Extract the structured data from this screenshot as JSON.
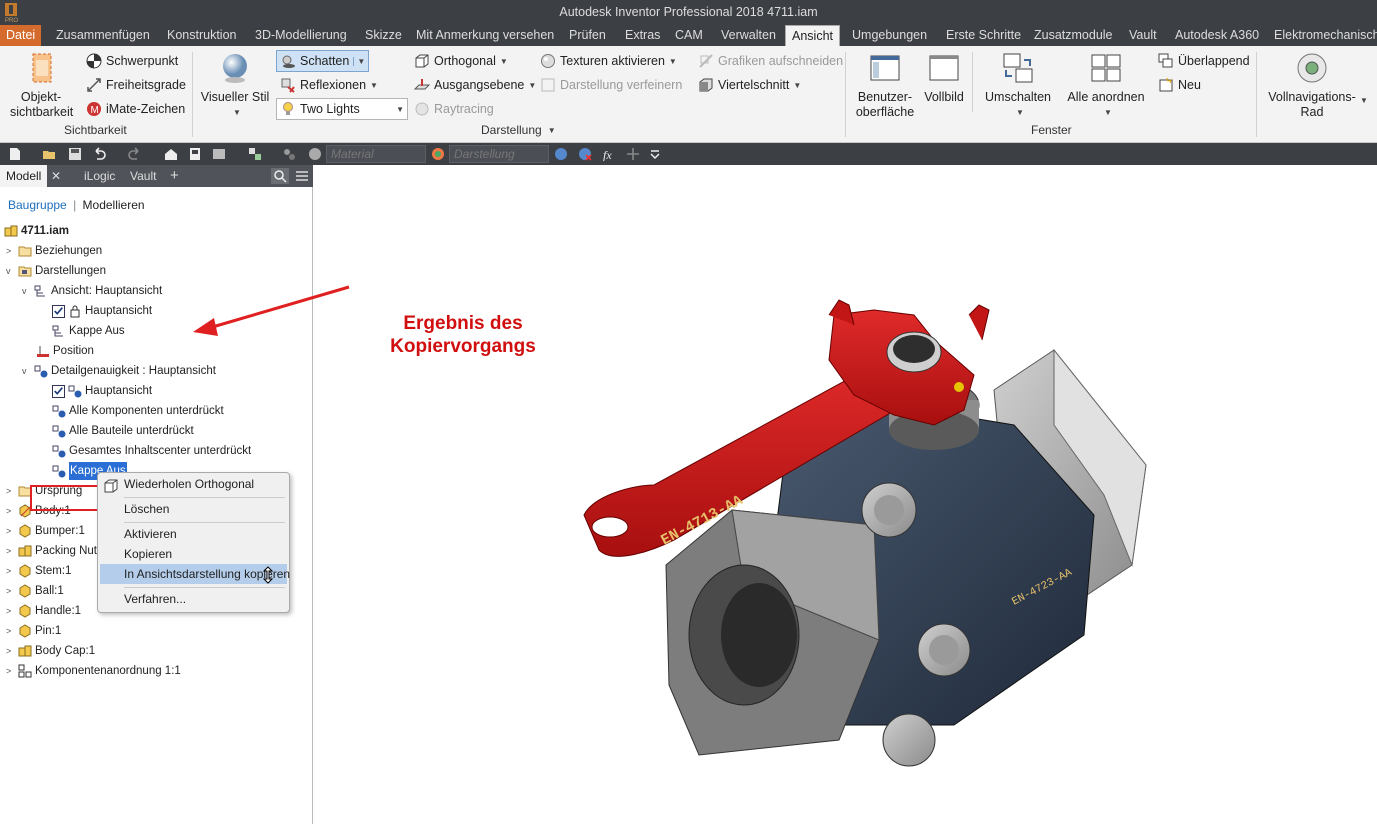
{
  "window": {
    "title": "Autodesk Inventor Professional 2018    4711.iam"
  },
  "tabs": [
    "Datei",
    "Zusammenfügen",
    "Konstruktion",
    "3D-Modellierung",
    "Skizze",
    "Mit Anmerkung versehen",
    "Prüfen",
    "Extras",
    "CAM",
    "Verwalten",
    "Ansicht",
    "Umgebungen",
    "Erste Schritte",
    "Zusatzmodule",
    "Vault",
    "Autodesk A360",
    "Elektromechanisch"
  ],
  "active_tab": "Ansicht",
  "ribbon": {
    "sichtbarkeit": {
      "objekt": "Objekt-",
      "objekt2": "sichtbarkeit",
      "schwerpunkt": "Schwerpunkt",
      "freiheitsgrade": "Freiheitsgrade",
      "imate": "iMate-Zeichen",
      "label": "Sichtbarkeit"
    },
    "darstellung": {
      "visueller_stil": "Visueller Stil",
      "schatten": "Schatten",
      "reflexionen": "Reflexionen",
      "two_lights": "Two Lights",
      "orthogonal": "Orthogonal",
      "ausgangsebene": "Ausgangsebene",
      "raytracing": "Raytracing",
      "texturen": "Texturen aktivieren",
      "darstellung_verfeinern": "Darstellung verfeinern",
      "grafiken": "Grafiken aufschneiden",
      "viertelschnitt": "Viertelschnitt",
      "label": "Darstellung"
    },
    "fenster": {
      "benutzer": "Benutzer-",
      "benutzer2": "oberfläche",
      "vollbild": "Vollbild",
      "umschalten": "Umschalten",
      "alle_anordnen": "Alle anordnen",
      "ueberlappend": "Überlappend",
      "neu": "Neu",
      "label": "Fenster"
    },
    "navigation": {
      "voll": "Vollnavigations-",
      "rad": "Rad"
    }
  },
  "qat": {
    "material_placeholder": "Material",
    "darstellung_placeholder": "Darstellung"
  },
  "browser": {
    "tabs": {
      "modell": "Modell",
      "ilogic": "iLogic",
      "vault": "Vault",
      "add": "+"
    },
    "subtabs": {
      "baugruppe": "Baugruppe",
      "sep": "|",
      "modellieren": "Modellieren"
    },
    "tree": [
      {
        "label": "4711.iam"
      },
      {
        "label": "Beziehungen"
      },
      {
        "label": "Darstellungen"
      },
      {
        "label": "Ansicht: Hauptansicht"
      },
      {
        "label": "Hauptansicht"
      },
      {
        "label": "Kappe Aus"
      },
      {
        "label": "Position"
      },
      {
        "label": "Detailgenauigkeit : Hauptansicht"
      },
      {
        "label": "Hauptansicht"
      },
      {
        "label": "Alle Komponenten unterdrückt"
      },
      {
        "label": "Alle Bauteile unterdrückt"
      },
      {
        "label": "Gesamtes Inhaltscenter unterdrückt"
      },
      {
        "label": "Kappe Aus"
      },
      {
        "label": "Ursprung"
      },
      {
        "label": "Body:1"
      },
      {
        "label": "Bumper:1"
      },
      {
        "label": "Packing Nut:"
      },
      {
        "label": "Stem:1"
      },
      {
        "label": "Ball:1"
      },
      {
        "label": "Handle:1"
      },
      {
        "label": "Pin:1"
      },
      {
        "label": "Body Cap:1"
      },
      {
        "label": "Komponentenanordnung 1:1"
      }
    ]
  },
  "context_menu": [
    "Wiederholen Orthogonal",
    "Löschen",
    "Aktivieren",
    "Kopieren",
    "In Ansichtsdarstellung kopieren",
    "Verfahren..."
  ],
  "annotation": {
    "line1": "Ergebnis des",
    "line2": "Kopiervorgangs"
  },
  "model_text": {
    "handle": "EN-4713-AA",
    "body": "EN-4723-AA"
  },
  "colors": {
    "accent": "#d46a2c",
    "handle": "#d21515",
    "highlight": "#b4cdea",
    "annotation": "#d10f0f"
  }
}
